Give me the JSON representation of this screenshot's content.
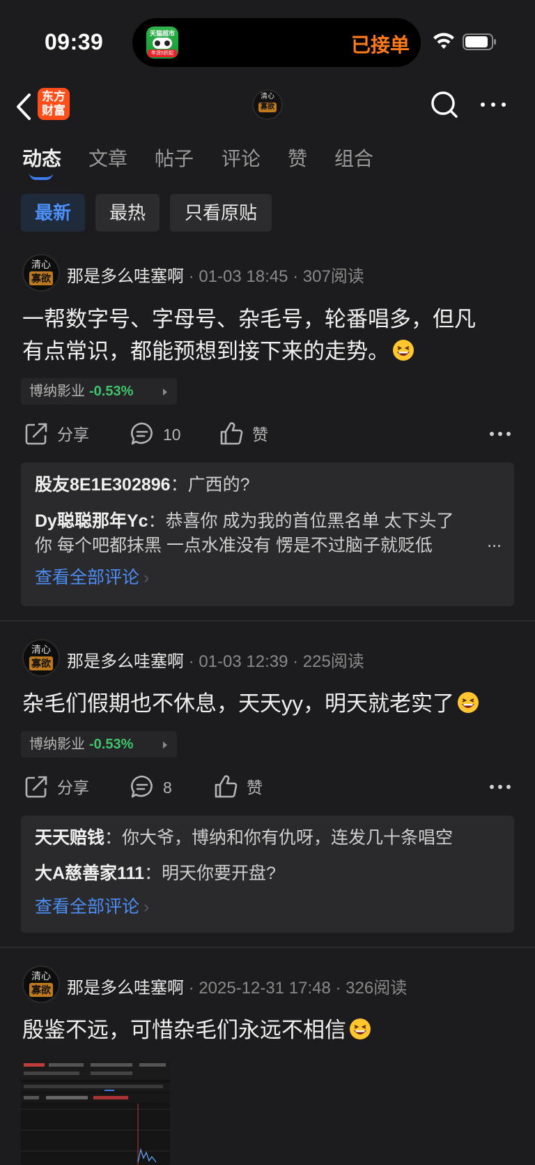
{
  "status_bar": {
    "time": "09:39",
    "island_text": "已接单",
    "island_app_top": "天猫超市",
    "island_app_bottom": "年货5折起"
  },
  "nav": {
    "brand_logo": "东方\n财富",
    "avatar_top": "清心",
    "avatar_bottom": "寡欲"
  },
  "tabs": [
    "动态",
    "文章",
    "帖子",
    "评论",
    "赞",
    "组合"
  ],
  "filters": [
    "最新",
    "最热",
    "只看原贴"
  ],
  "posts": [
    {
      "author": "那是多么哇塞啊",
      "avatar_top": "清心",
      "avatar_bottom": "寡欲",
      "meta": " · 01-03 18:45 · 307阅读",
      "content_l1": "一帮数字号、字母号、杂毛号，轮番唱多，但凡",
      "content_l2": "有点常识，都能预想到接下来的走势。",
      "stock_name": "博纳影业",
      "stock_change": "-0.53%",
      "share": "分享",
      "comment_count": "10",
      "like": "赞",
      "comments": [
        {
          "name": "股友8E1E302896",
          "text": "：广西的?"
        },
        {
          "name": "Dy聪聪那年Yc",
          "text": "：恭喜你 成为我的首位黑名单 太下头了",
          "text2": "你 每个吧都抹黑 一点水准没有 愣是不过脑子就贬低"
        }
      ],
      "more": "...",
      "view_all": "查看全部评论"
    },
    {
      "author": "那是多么哇塞啊",
      "avatar_top": "清心",
      "avatar_bottom": "寡欲",
      "meta": " · 01-03 12:39 · 225阅读",
      "content_l1": "杂毛们假期也不休息，天天yy，明天就老实了",
      "stock_name": "博纳影业",
      "stock_change": "-0.53%",
      "share": "分享",
      "comment_count": "8",
      "like": "赞",
      "comments": [
        {
          "name": "天天赔钱",
          "text": "：你大爷，博纳和你有仇呀，连发几十条唱空"
        },
        {
          "name": "大A慈善家111",
          "text": "：明天你要开盘?"
        }
      ],
      "view_all": "查看全部评论"
    },
    {
      "author": "那是多么哇塞啊",
      "avatar_top": "清心",
      "avatar_bottom": "寡欲",
      "meta": " · 2025-12-31 17:48 · 326阅读",
      "content_l1": "殷鉴不远，可惜杂毛们永远不相信"
    }
  ],
  "colors": {
    "accent_blue": "#4c8ef5",
    "stock_green": "#3ec46d",
    "island_orange": "#ff7a1a",
    "brand_orange": "#ff4e1a"
  },
  "icons": [
    "back-chevron-icon",
    "search-icon",
    "more-dots-icon",
    "share-icon",
    "comment-icon",
    "like-icon",
    "laugh-emoji-icon",
    "wifi-icon",
    "battery-icon"
  ]
}
